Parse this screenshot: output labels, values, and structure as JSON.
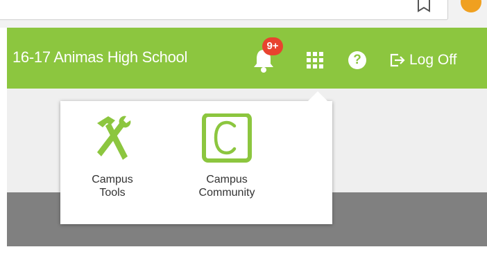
{
  "header": {
    "school_name": "16-17 Animas High School",
    "notification_badge": "9+",
    "logoff_label": "Log Off",
    "help_glyph": "?"
  },
  "icons": {
    "bell": "bell-icon",
    "apps": "app-grid-icon",
    "help": "help-circle-icon",
    "logoff": "logoff-icon",
    "bookmark": "bookmark-star-icon",
    "extension": "extension-icon",
    "campus_tools": "hammer-wrench-icon",
    "campus_community": "letter-c-box-icon"
  },
  "app_menu": {
    "items": [
      {
        "label": "Campus\nTools"
      },
      {
        "label": "Campus\nCommunity"
      }
    ]
  },
  "colors": {
    "brand_green": "#8cc63f",
    "badge_red": "#e8432f",
    "band_gray": "#808080"
  }
}
